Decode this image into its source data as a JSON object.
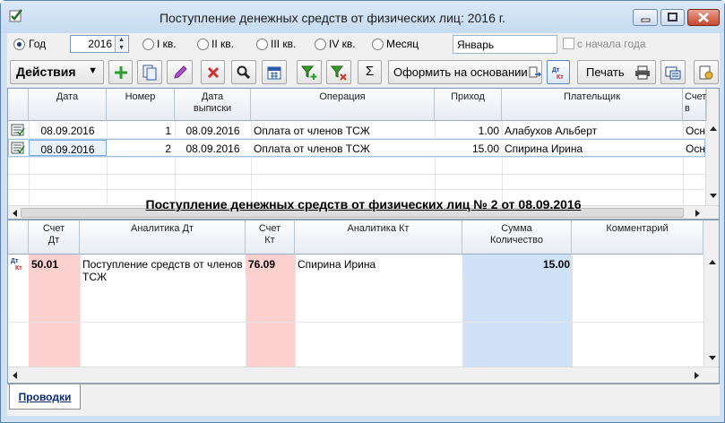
{
  "window": {
    "title": "Поступление денежных средств от физических лиц: 2016 г."
  },
  "period": {
    "options": [
      {
        "label": "Год",
        "selected": true
      },
      {
        "label": "I кв.",
        "selected": false
      },
      {
        "label": "II кв.",
        "selected": false
      },
      {
        "label": "III кв.",
        "selected": false
      },
      {
        "label": "IV кв.",
        "selected": false
      },
      {
        "label": "Месяц",
        "selected": false
      }
    ],
    "year": "2016",
    "month": "Январь",
    "since_start_label": "с начала года"
  },
  "toolbar": {
    "actions_label": "Действия",
    "base_label": "Оформить на основании",
    "print_label": "Печать",
    "icons": [
      "plus-icon",
      "copy-icon",
      "edit-icon",
      "delete-icon",
      "search-icon",
      "calendar-icon",
      "filter-add-icon",
      "filter-remove-icon",
      "sum-icon",
      "dt-kt-icon",
      "printer-icon",
      "settings-icon",
      "exit-icon"
    ],
    "colors": {
      "add": "#2e9e2e",
      "delete": "#d03030",
      "edit": "#a040c0"
    }
  },
  "doc_table": {
    "headers": [
      "Дата",
      "Номер",
      "Дата выписки",
      "Операция",
      "Приход",
      "Плательщик",
      "Счет в"
    ],
    "rows": [
      {
        "date": "08.09.2016",
        "number": "1",
        "stmt_date": "08.09.2016",
        "operation": "Оплата от членов ТСЖ",
        "income": "1.00",
        "payer": "Алабухов Альберт",
        "account": "Осн"
      },
      {
        "date": "08.09.2016",
        "number": "2",
        "stmt_date": "08.09.2016",
        "operation": "Оплата от членов ТСЖ",
        "income": "15.00",
        "payer": "Спирина Ирина",
        "account": "Осн"
      }
    ]
  },
  "detail": {
    "title": "Поступление денежных средств от физических лиц № 2 от 08.09.2016",
    "headers": [
      "Счет Дт",
      "Аналитика Дт",
      "Счет Кт",
      "Аналитика Кт",
      "Сумма Количество",
      "Комментарий"
    ],
    "rows": [
      {
        "debit_account": "50.01",
        "debit_analytics": "Поступление средств от членов ТСЖ",
        "credit_account": "76.09",
        "credit_analytics": "Спирина Ирина",
        "amount": "15.00",
        "comment": ""
      }
    ],
    "colors": {
      "account_bg": "#fdd0d0",
      "amount_bg": "#cfe2f8"
    }
  },
  "tabs": [
    {
      "label": "Проводки"
    }
  ]
}
